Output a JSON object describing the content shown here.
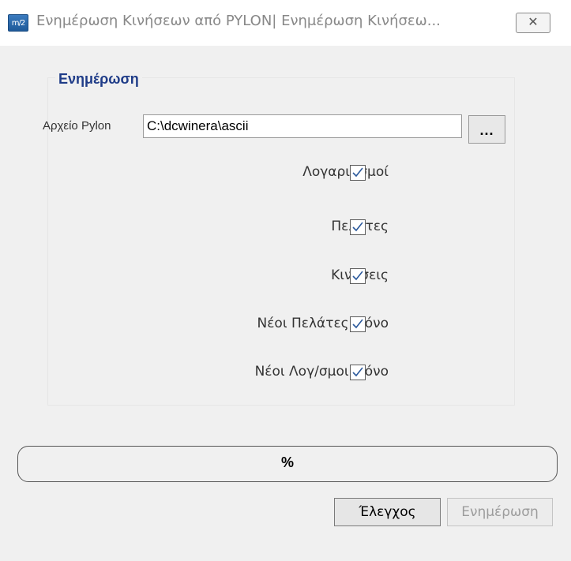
{
  "window": {
    "title": "Ενημέρωση Κινήσεων από PYLON| Ενημέρωση Κινήσεω...",
    "app_icon_text": "m/2",
    "close_glyph": "✕"
  },
  "group": {
    "title": "Ενημέρωση"
  },
  "file": {
    "label": "Αρχείο Pylon",
    "value": "C:\\dcwinera\\ascii",
    "browse_label": "..."
  },
  "options": [
    {
      "label": "Λογαριασμοί",
      "checked": true
    },
    {
      "label": "Πελάτες",
      "checked": true
    },
    {
      "label": "Κινήσεις",
      "checked": true
    },
    {
      "label": "Νέοι Πελάτες Μόνο",
      "checked": true
    },
    {
      "label": "Νέοι Λογ/σμοι Μόνο",
      "checked": true
    }
  ],
  "progress": {
    "text": "%",
    "value": 0
  },
  "buttons": {
    "check_label": "Έλεγχος",
    "update_label": "Ενημέρωση"
  },
  "colors": {
    "group_title": "#1f3c88",
    "check_mark": "#2c5a9c",
    "disabled_text": "#9c9c9c"
  }
}
